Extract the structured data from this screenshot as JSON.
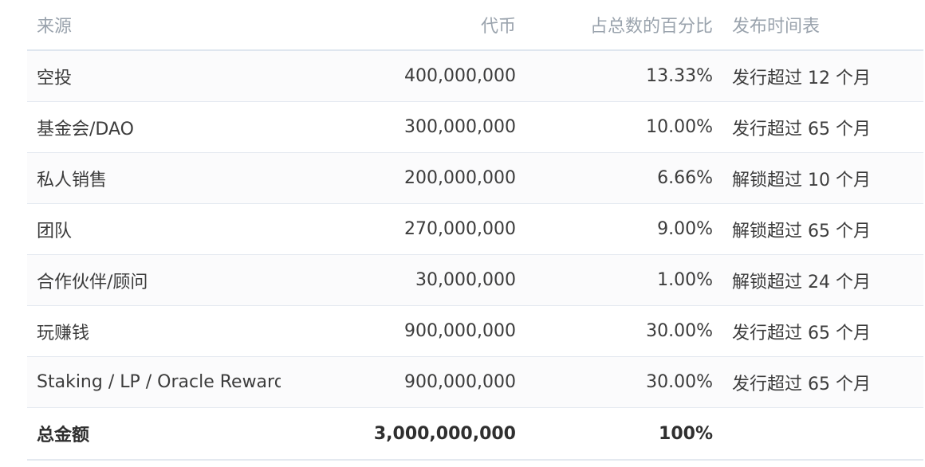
{
  "table": {
    "headers": [
      "来源",
      "代币",
      "占总数的百分比",
      "发布时间表"
    ],
    "rows": [
      [
        "空投",
        "400,000,000",
        "13.33%",
        "发行超过 12 个月"
      ],
      [
        "基金会/DAO",
        "300,000,000",
        "10.00%",
        "发行超过 65 个月"
      ],
      [
        "私人销售",
        "200,000,000",
        "6.66%",
        "解锁超过 10 个月"
      ],
      [
        "团队",
        "270,000,000",
        "9.00%",
        "解锁超过 65 个月"
      ],
      [
        "合作伙伴/顾问",
        "30,000,000",
        "1.00%",
        "解锁超过 24 个月"
      ],
      [
        "玩赚钱",
        "900,000,000",
        "30.00%",
        "发行超过 65 个月"
      ],
      [
        "Staking / LP / Oracle Rewards",
        "900,000,000",
        "30.00%",
        "发行超过 65 个月"
      ]
    ],
    "total": [
      "总金额",
      "3,000,000,000",
      "100%",
      ""
    ]
  }
}
